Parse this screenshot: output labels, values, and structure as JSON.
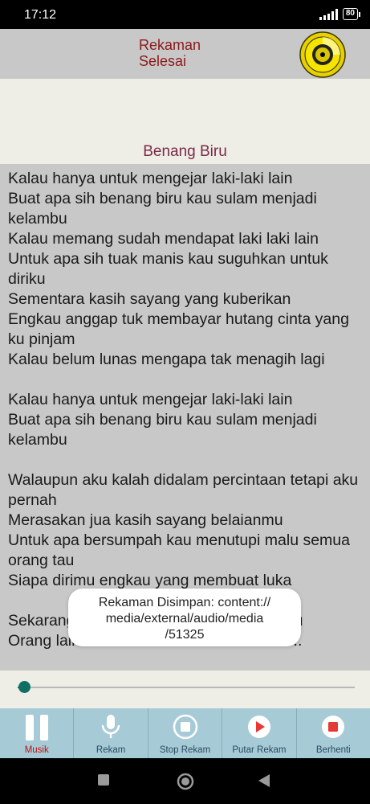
{
  "status": {
    "time": "17:12",
    "battery": "80"
  },
  "header": {
    "title_line1": "Rekaman",
    "title_line2": "Selesai"
  },
  "song": {
    "title": "Benang Biru"
  },
  "lyrics": [
    [
      "Kalau hanya untuk mengejar laki-laki lain",
      "Buat apa sih benang biru kau sulam menjadi kelambu",
      "Kalau memang sudah mendapat laki laki lain",
      "Untuk apa sih tuak manis kau suguhkan untuk diriku",
      "Sementara kasih sayang yang kuberikan",
      "Engkau anggap tuk membayar hutang cinta yang ku pinjam",
      "Kalau belum lunas mengapa tak menagih lagi"
    ],
    [
      "Kalau hanya untuk mengejar laki-laki lain",
      "Buat apa sih benang biru kau sulam menjadi kelambu"
    ],
    [
      "Walaupun aku kalah didalam percintaan tetapi aku pernah",
      "Merasakan jua kasih sayang belaianmu",
      "Untuk apa bersumpah kau menutupi malu semua orang tau",
      "Siapa dirimu engkau yang membuat luka"
    ],
    [
      "Sekarang aku telah hidup tenang tanpamu",
      "Orang lain sudah bersama kamu saat ini .."
    ]
  ],
  "toast": {
    "message": "Rekaman Disimpan: content://media/external/audio/media/51325",
    "line1": "Rekaman Disimpan: content://",
    "line2": "media/external/audio/media",
    "line3": "/51325"
  },
  "player": {
    "progress": 0.02
  },
  "bottom_nav": [
    {
      "label": "Musik",
      "icon": "pause-icon",
      "active": true
    },
    {
      "label": "Rekam",
      "icon": "microphone-icon",
      "active": false
    },
    {
      "label": "Stop Rekam",
      "icon": "stop-circle-icon",
      "active": false
    },
    {
      "label": "Putar Rekam",
      "icon": "play-circle-icon",
      "active": false
    },
    {
      "label": "Berhenti",
      "icon": "stop-record-icon",
      "active": false
    }
  ],
  "colors": {
    "header_text": "#8b1a1a",
    "title_text": "#7a2a4a",
    "accent": "#0f6f62",
    "nav_bg": "#a6cbd7",
    "active_label": "#c01010"
  }
}
